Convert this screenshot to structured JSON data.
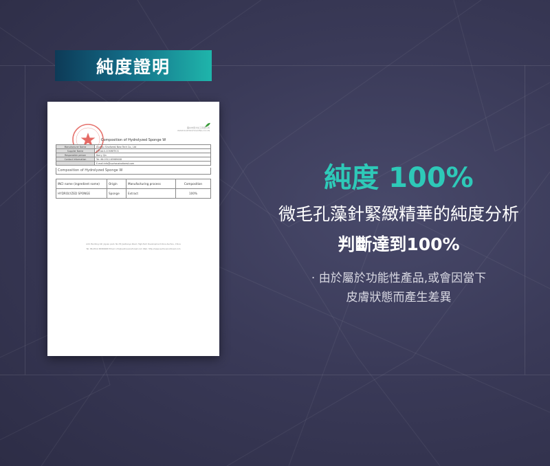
{
  "header": {
    "title": "純度證明"
  },
  "document": {
    "company_lines": [
      "蘇州市家大化工有限公司",
      "WWW.SUZHOUHUAXING.CO.CN"
    ],
    "title": "Composition of Hydrolyzed Sponge W",
    "info_rows": [
      {
        "label": "Manufacturer Name",
        "value": "Suzhou Sinoforest New Tech Co., Ltd"
      },
      {
        "label": "Supplier Name",
        "value": "HYGALS-COSMETICS"
      },
      {
        "label": "Responsible person",
        "value": "Barry Qin"
      },
      {
        "label": "Contact Information",
        "value": "Tel: 86-0512-65989008"
      },
      {
        "label": "",
        "value": "E-mail:info@suzhousinoforest.com"
      }
    ],
    "composition_title": "Composition of Hydrolyzed Sponge W",
    "table_headers": [
      "INCI name (ingredient name)",
      "Origin",
      "Manufacturing process",
      "Composition"
    ],
    "table_rows": [
      [
        "HYDROLYZED SPONGE",
        "Sponge",
        "Extract",
        "100%"
      ]
    ],
    "footer_1": "Add: Building 4#, Jiguan park, No.55 Jiaotiaoye Road, High-Tech Development Zone,Suzhou, China",
    "footer_2": "Tel: 86-0512-65989008     Email: info@suzhousinoforest.com     Web: http://www.suzhousinoforest.com"
  },
  "content": {
    "headline": "純度 100%",
    "line1": "微毛孔藻針緊緻精華的純度分析",
    "line2": "判斷達到100%",
    "note1": "· 由於屬於功能性產品,或會因當下",
    "note2": "皮膚狀態而產生差異"
  },
  "colors": {
    "accent": "#2ec9b8",
    "background": "#34344f",
    "ribbon_start": "#0d3a57",
    "ribbon_end": "#1fb5ab",
    "stamp": "#e0504a"
  }
}
